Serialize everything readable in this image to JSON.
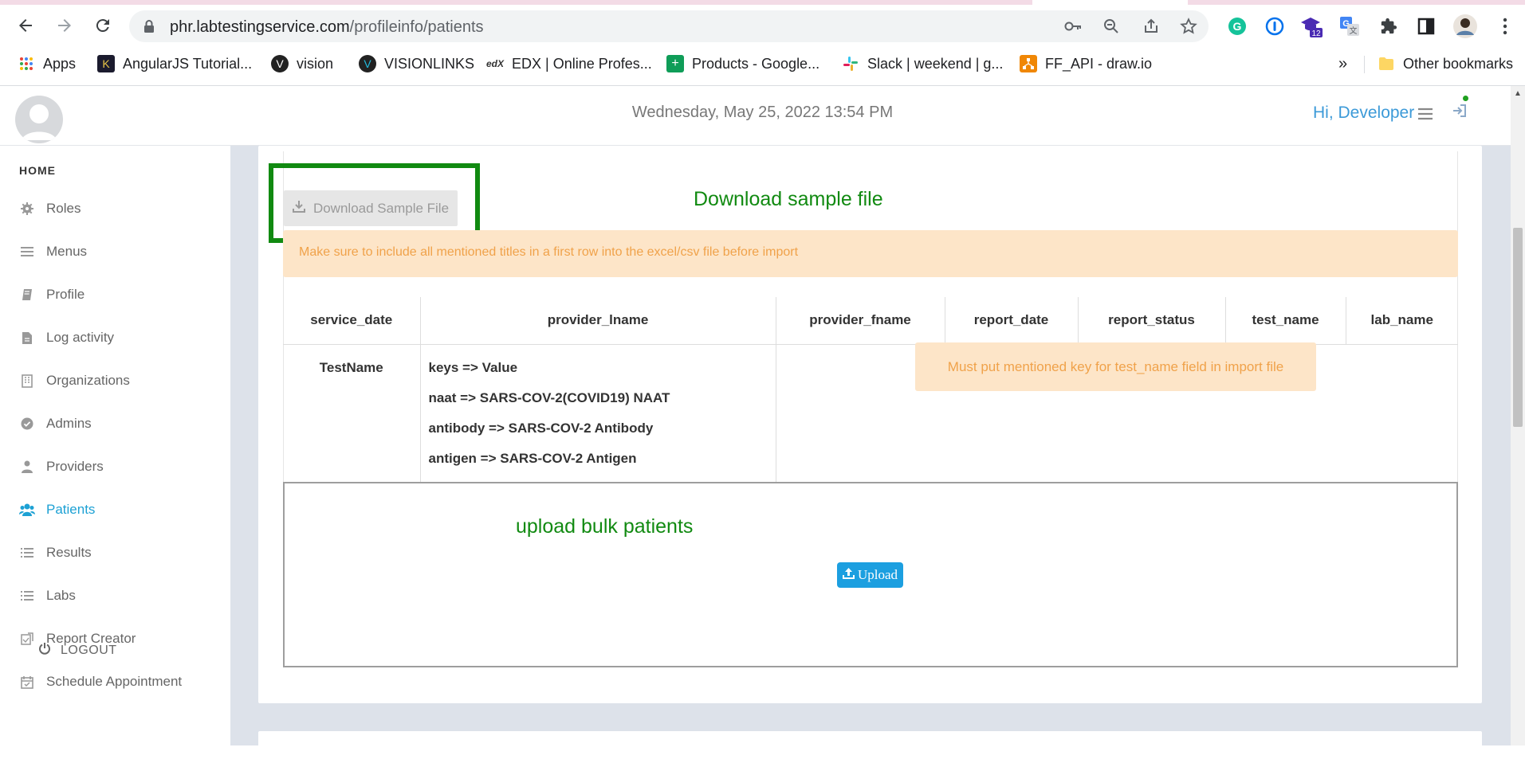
{
  "browser": {
    "url_host": "phr.labtestingservice.com",
    "url_path": "/profileinfo/patients",
    "extension_badge": "12",
    "bookmarks": [
      {
        "label": "Apps"
      },
      {
        "label": "AngularJS Tutorial..."
      },
      {
        "label": "vision"
      },
      {
        "label": "VISIONLINKS"
      },
      {
        "label": "EDX | Online Profes..."
      },
      {
        "label": "Products - Google..."
      },
      {
        "label": "Slack | weekend | g..."
      },
      {
        "label": "FF_API - draw.io"
      }
    ],
    "overflow": "»",
    "other_bookmarks": "Other bookmarks"
  },
  "header": {
    "datetime": "Wednesday, May 25, 2022 13:54 PM",
    "greeting": "Hi, Developer"
  },
  "sidebar": {
    "home": "HOME",
    "items": [
      {
        "label": "Roles",
        "icon": "gear-icon"
      },
      {
        "label": "Menus",
        "icon": "bars-icon"
      },
      {
        "label": "Profile",
        "icon": "book-icon"
      },
      {
        "label": "Log activity",
        "icon": "file-icon"
      },
      {
        "label": "Organizations",
        "icon": "building-icon"
      },
      {
        "label": "Admins",
        "icon": "check-circle-icon"
      },
      {
        "label": "Providers",
        "icon": "user-md-icon"
      },
      {
        "label": "Patients",
        "icon": "users-icon",
        "active": true
      },
      {
        "label": "Results",
        "icon": "list-icon"
      },
      {
        "label": "Labs",
        "icon": "list-icon"
      },
      {
        "label": "Report Creator",
        "icon": "report-icon"
      },
      {
        "label": "Schedule Appointment",
        "icon": "calendar-check-icon"
      }
    ],
    "logout": "LOGOUT"
  },
  "main": {
    "download_button": "Download Sample File",
    "annotation_download": "Download sample file",
    "notice": "Make sure to include all mentioned titles in a first row into the excel/csv file before import",
    "columns": [
      "service_date",
      "provider_lname",
      "provider_fname",
      "report_date",
      "report_status",
      "test_name",
      "lab_name"
    ],
    "row_label": "TestName",
    "keys": [
      "keys => Value",
      "naat => SARS-COV-2(COVID19) NAAT",
      "antibody => SARS-COV-2 Antibody",
      "antigen => SARS-COV-2 Antigen"
    ],
    "test_name_warning": "Must put mentioned key for test_name field in import file",
    "annotation_upload": "upload bulk patients",
    "upload_button": "Upload"
  },
  "colors": {
    "accent": "#1da1d4",
    "annotation_green": "#118a11",
    "warning_bg": "#fde5c8",
    "warning_text": "#f0a24a"
  }
}
